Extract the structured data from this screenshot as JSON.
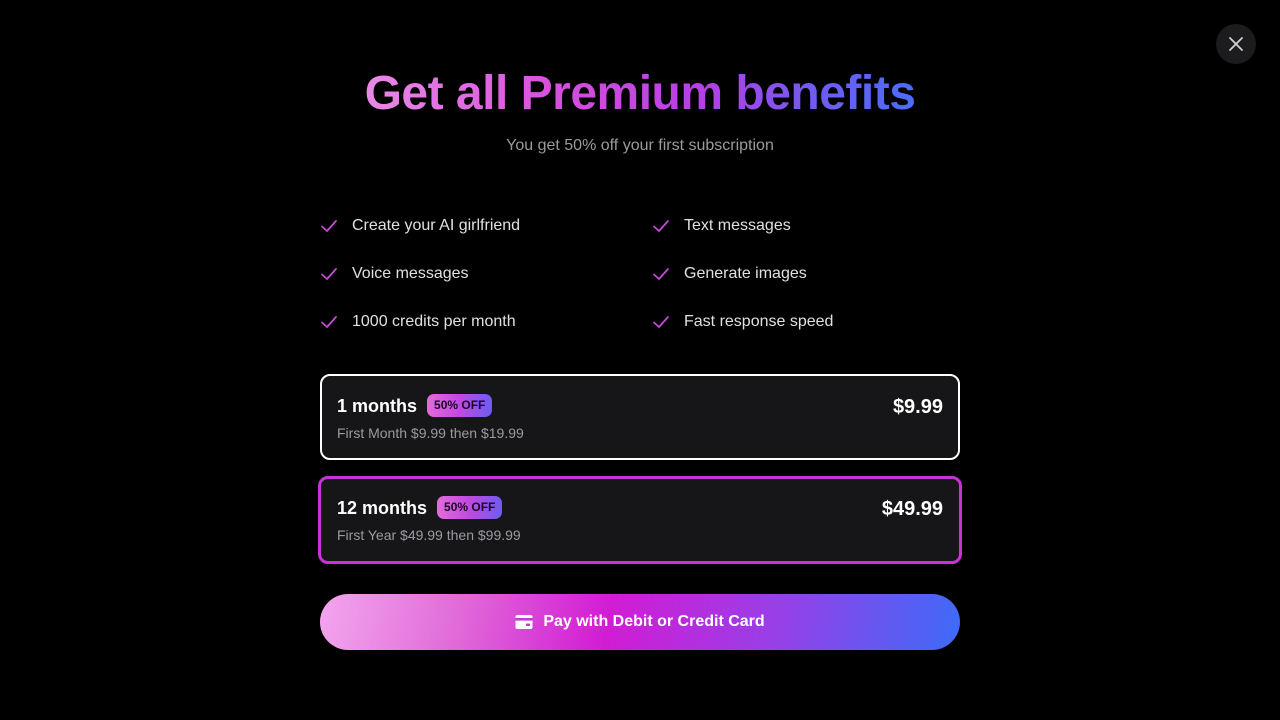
{
  "header": {
    "title": "Get all Premium benefits",
    "subtitle": "You get 50% off your first subscription"
  },
  "benefits": [
    {
      "label": "Create your AI girlfriend",
      "icon": "check-icon"
    },
    {
      "label": "Text messages",
      "icon": "check-icon"
    },
    {
      "label": "Voice messages",
      "icon": "check-icon"
    },
    {
      "label": "Generate images",
      "icon": "check-icon"
    },
    {
      "label": "1000 credits per month",
      "icon": "check-icon"
    },
    {
      "label": "Fast response speed",
      "icon": "check-icon"
    }
  ],
  "plans": [
    {
      "name": "1 months",
      "badge": "50% OFF",
      "description": "First Month $9.99 then $19.99",
      "price": "$9.99",
      "state": "unselected"
    },
    {
      "name": "12 months",
      "badge": "50% OFF",
      "description": "First Year $49.99 then $99.99",
      "price": "$49.99",
      "state": "selected"
    }
  ],
  "pay_button": {
    "label": "Pay with Debit or Credit Card",
    "icon": "credit-card-icon"
  },
  "close_icon": "close-icon",
  "colors": {
    "background": "#000000",
    "card_background": "#161618",
    "accent_magenta": "#c932d6",
    "accent_blue": "#3d6bf8",
    "check": "#c848d8"
  }
}
